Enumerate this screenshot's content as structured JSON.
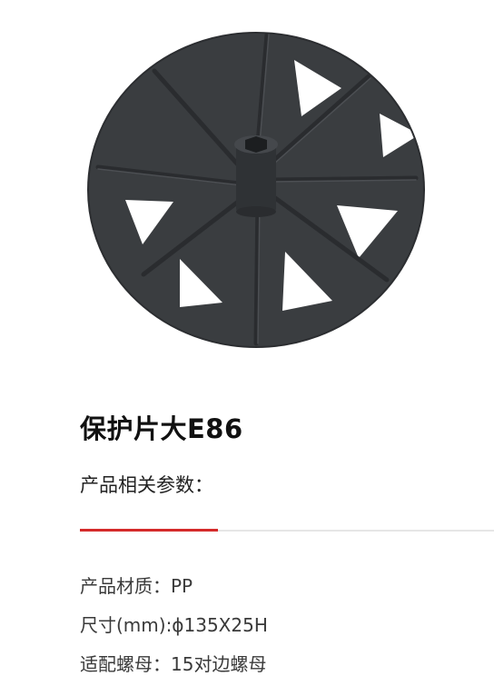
{
  "product": {
    "title": "保护片大E86",
    "image_color": "#3a3d40"
  },
  "params_heading": "产品相关参数：",
  "accent_color": "#d42a2a",
  "specs": [
    {
      "text": "产品材质：PP"
    },
    {
      "text": "尺寸(mm):ϕ135X25H"
    },
    {
      "text": "适配螺母：15对边螺母"
    }
  ]
}
